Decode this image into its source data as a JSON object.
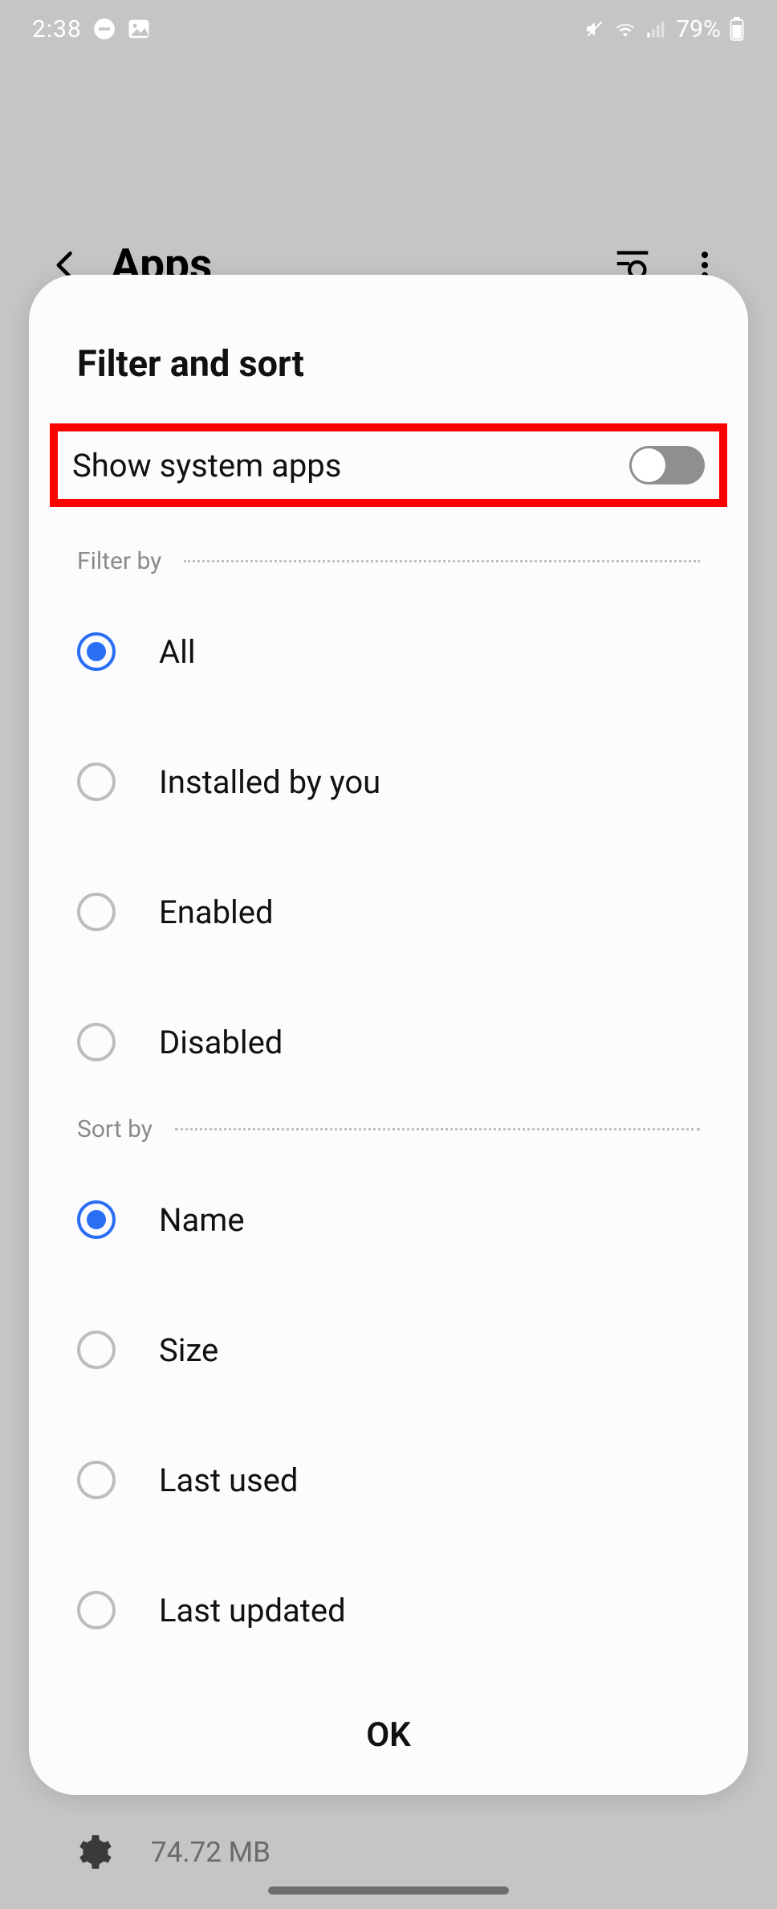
{
  "status": {
    "time": "2:38",
    "battery_pct": "79%"
  },
  "header": {
    "title": "Apps"
  },
  "modal": {
    "title": "Filter and sort",
    "toggle": {
      "label": "Show system apps",
      "on": false
    },
    "filter_label": "Filter by",
    "filter_options": [
      {
        "label": "All",
        "selected": true
      },
      {
        "label": "Installed by you",
        "selected": false
      },
      {
        "label": "Enabled",
        "selected": false
      },
      {
        "label": "Disabled",
        "selected": false
      }
    ],
    "sort_label": "Sort by",
    "sort_options": [
      {
        "label": "Name",
        "selected": true
      },
      {
        "label": "Size",
        "selected": false
      },
      {
        "label": "Last used",
        "selected": false
      },
      {
        "label": "Last updated",
        "selected": false
      }
    ],
    "ok_label": "OK"
  },
  "bg_peek": {
    "size_text": "74.72 MB"
  }
}
